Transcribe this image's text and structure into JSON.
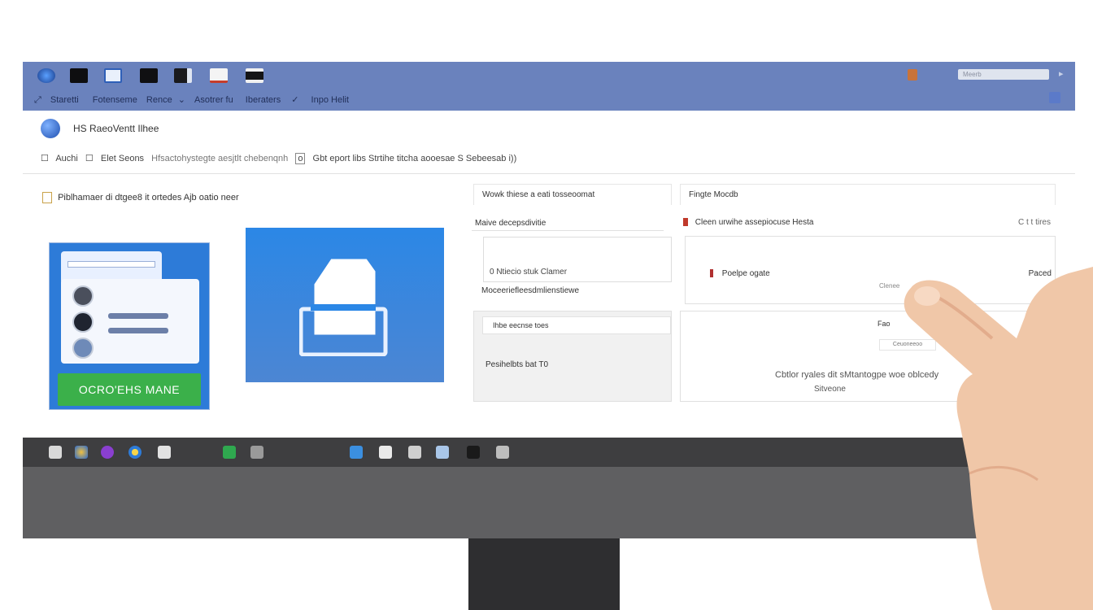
{
  "titlebar": {
    "menu": [
      "Staretti",
      "Fotenseme",
      "Rence",
      "Asotrer fu",
      "Iberaters",
      "Inpo Helit"
    ],
    "search_placeholder": "Meerb",
    "arrow": "▸"
  },
  "app": {
    "title": "HS  RaeoVentt Ilhee",
    "toolbar": [
      "Auchi",
      "Elet Seons",
      "Hfsactohystegte aesjtlt chebenqnh",
      "o",
      "Gbt eport libs  Strtihe  titcha aooesae  S Sebeesab i))"
    ]
  },
  "left": {
    "caption": "Piblhamaer  di dtgee8 it ortedes Ajb oatio  neer",
    "cta_label": "OCRO'EHS MANE"
  },
  "middle": {
    "header": "Wowk  thiese a eati tosseoomat",
    "sub": "Maive  decepsdivitie",
    "box_text": "0  Ntiecio stuk  Clamer",
    "row": "Moceeriefleesdmlienstiewe",
    "field": "Ihbe  eecnse toes",
    "row2": "Pesihelbts  bat T0"
  },
  "right": {
    "header": "Fingte Mocdb",
    "row1_label": "Cleen  urwihe  assepiocuse Hesta",
    "row1_right": "C t t  tires",
    "label": "Poelpe  ogate",
    "paced": "Paced",
    "close": "Clenee",
    "fo": "Fao",
    "button": "Ceuoneeoo",
    "text": "Cbtlor  ryales dit sMtantogpe woe oblcedy",
    "text2": "Sitveone"
  },
  "icons": {
    "titlebar": [
      "browser-icon",
      "terminal-icon",
      "window-icon",
      "monitor-icon",
      "app-icon",
      "mail-icon",
      "media-icon"
    ],
    "taskbar": [
      "mail-icon",
      "people-icon",
      "chat-icon",
      "chrome-icon",
      "grid-icon",
      "sheet-icon",
      "tools-icon",
      "photos-icon",
      "document-icon",
      "message-icon",
      "camera-icon",
      "media-icon",
      "edit-icon"
    ]
  },
  "colors": {
    "titlebar": "#6a82bd",
    "cta": "#3bb04a",
    "accent_blue": "#2d7bd8"
  }
}
